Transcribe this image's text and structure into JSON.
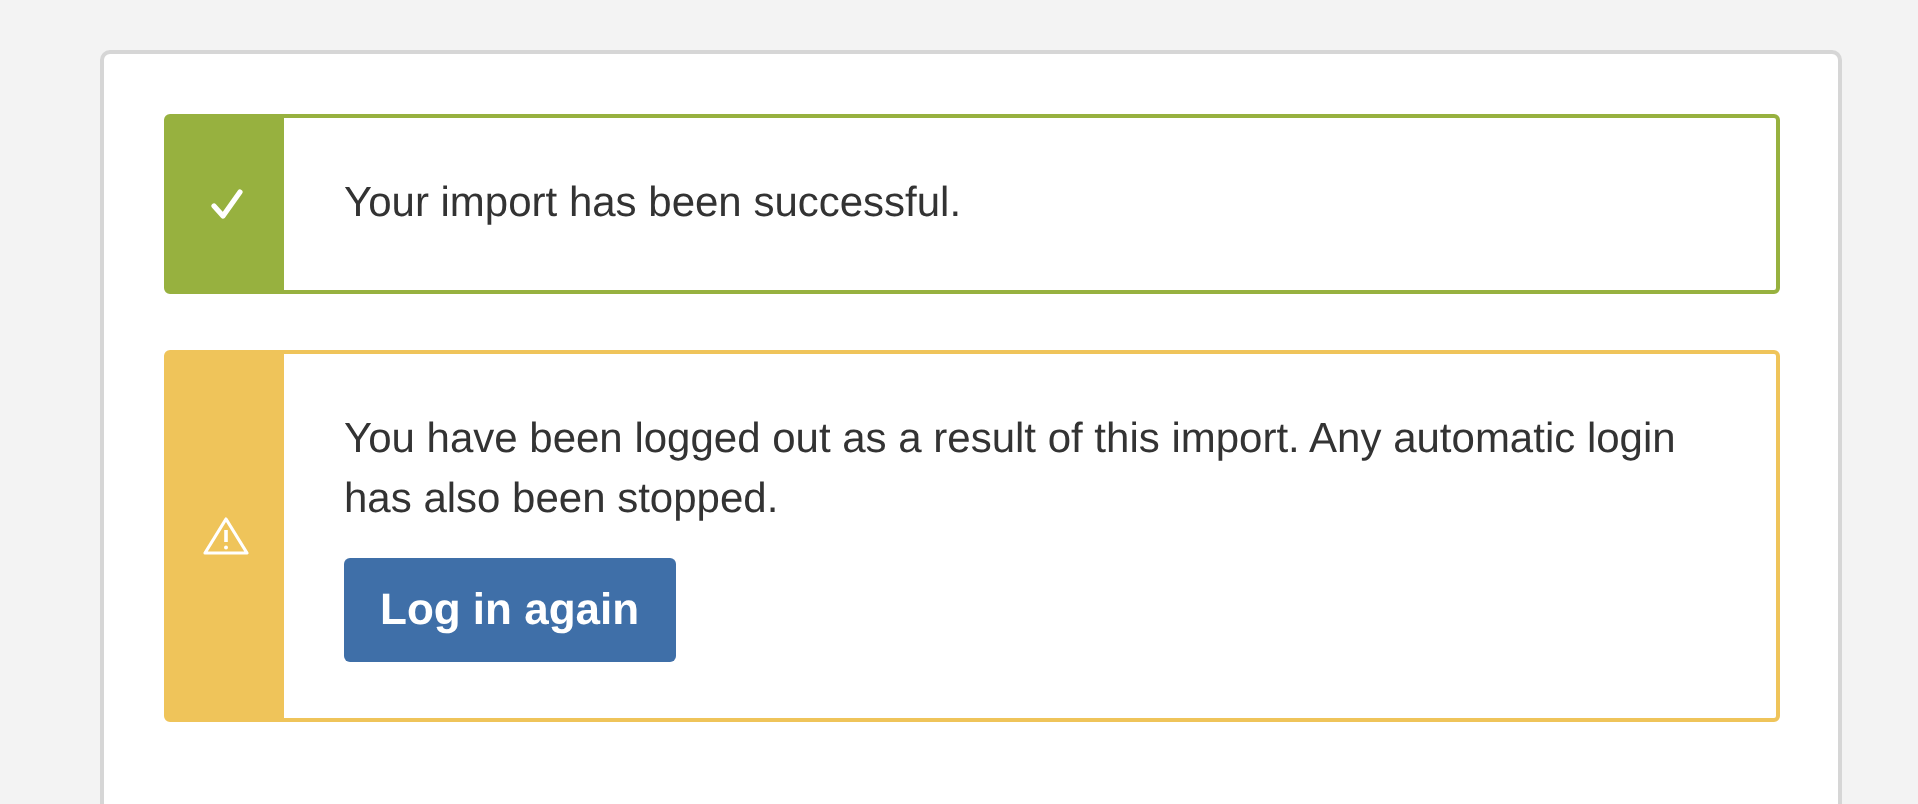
{
  "alerts": [
    {
      "kind": "success",
      "message": "Your import has been successful."
    },
    {
      "kind": "warning",
      "message": "You have been logged out as a result of this import. Any automatic login has also been stopped.",
      "button": "Log in again"
    }
  ]
}
